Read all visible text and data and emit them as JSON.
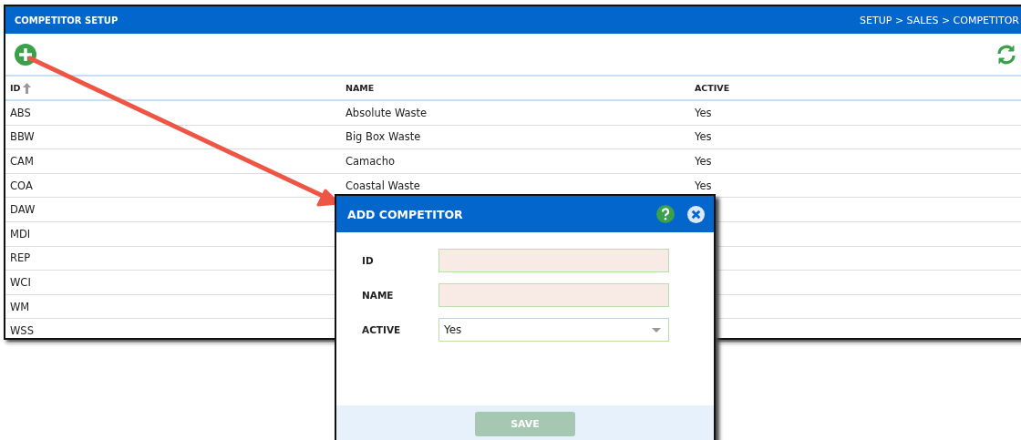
{
  "panel": {
    "title": "COMPETITOR SETUP",
    "breadcrumb": "SETUP > SALES > COMPETITOR"
  },
  "table": {
    "columns": [
      {
        "label": "ID",
        "sorted": true
      },
      {
        "label": "NAME",
        "sorted": false
      },
      {
        "label": "ACTIVE",
        "sorted": false
      }
    ],
    "rows": [
      {
        "id": "ABS",
        "name": "Absolute Waste",
        "active": "Yes"
      },
      {
        "id": "BBW",
        "name": "Big Box Waste",
        "active": "Yes"
      },
      {
        "id": "CAM",
        "name": "Camacho",
        "active": "Yes"
      },
      {
        "id": "COA",
        "name": "Coastal Waste",
        "active": "Yes"
      },
      {
        "id": "DAW"
      },
      {
        "id": "MDI"
      },
      {
        "id": "REP"
      },
      {
        "id": "WCI"
      },
      {
        "id": "WM"
      },
      {
        "id": "WSS"
      }
    ]
  },
  "dialog": {
    "title": "ADD COMPETITOR",
    "fields": [
      {
        "label": "ID",
        "kind": "text"
      },
      {
        "label": "NAME",
        "kind": "text"
      },
      {
        "label": "ACTIVE",
        "kind": "select",
        "value": "Yes"
      }
    ],
    "save_button": {
      "label": "SAVE",
      "disabled": true
    }
  }
}
